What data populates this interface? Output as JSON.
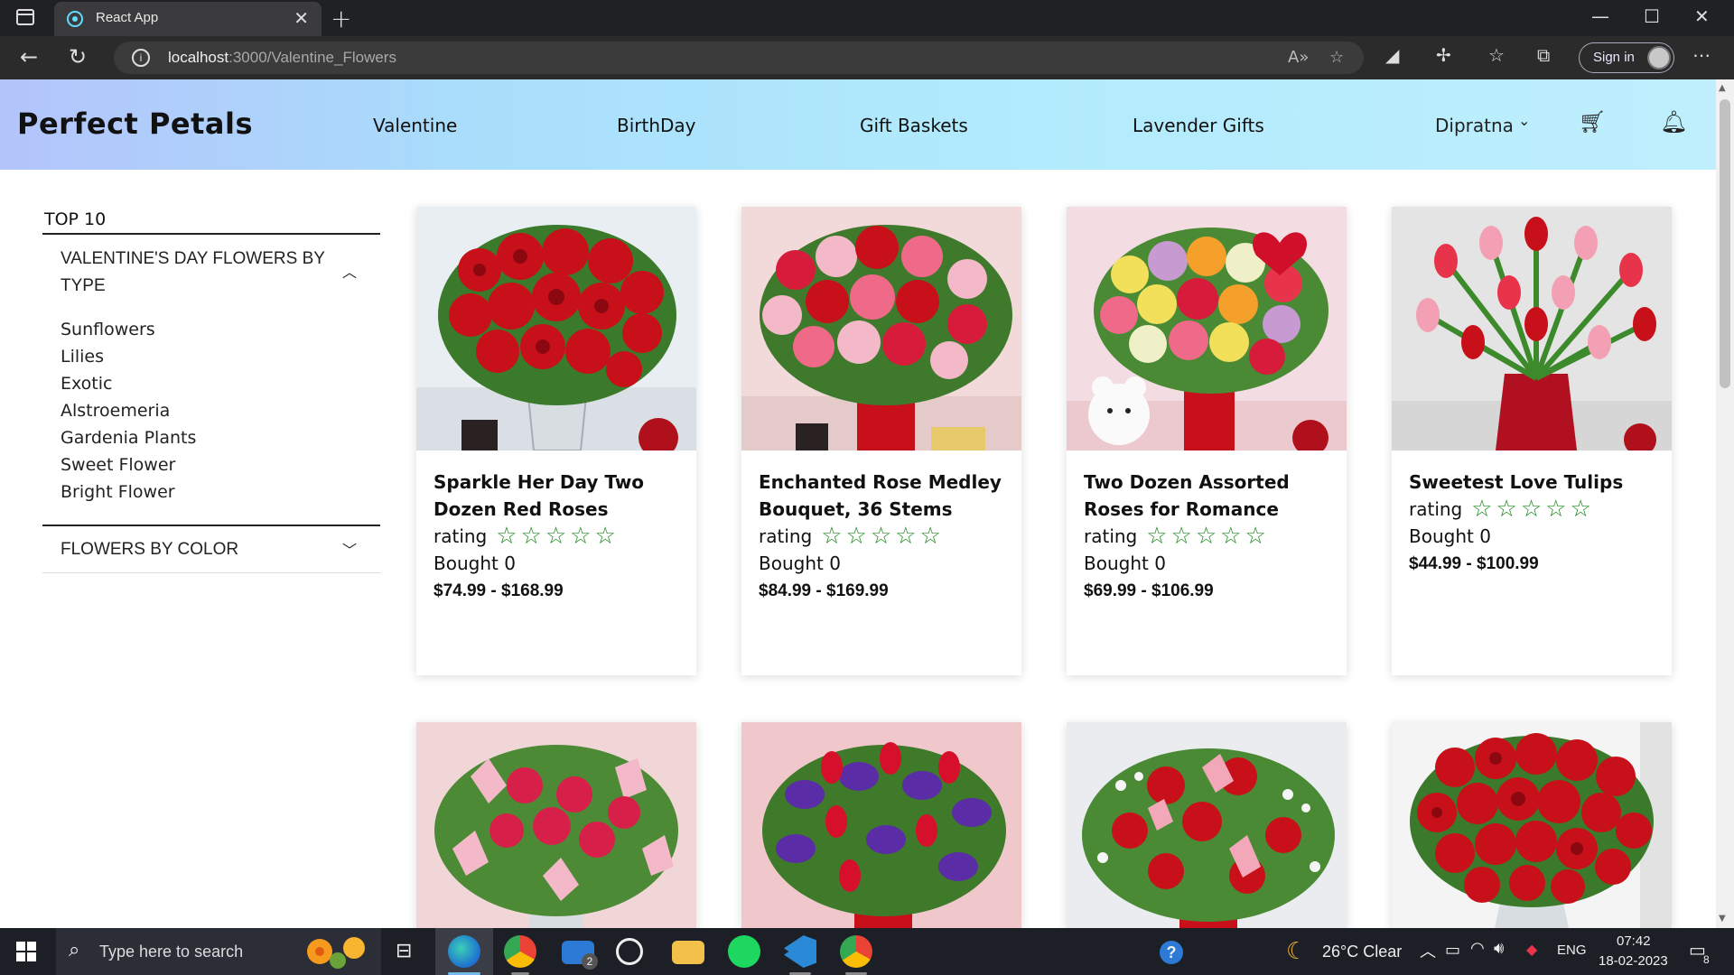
{
  "browser": {
    "tab_title": "React App",
    "tab_close": "✕",
    "new_tab": "+",
    "url_host": "localhost",
    "url_path": ":3000/Valentine_Flowers",
    "signin_label": "Sign in",
    "window_controls": [
      "—",
      "☐",
      "✕"
    ]
  },
  "header": {
    "brand": "Perfect Petals",
    "nav": [
      "Valentine",
      "BirthDay",
      "Gift Baskets",
      "Lavender Gifts"
    ],
    "user": "Dipratna",
    "icons": [
      "cart-icon",
      "bell-icon"
    ]
  },
  "sidebar": {
    "top": "TOP 10",
    "section1": "VALENTINE'S DAY FLOWERS BY TYPE",
    "items": [
      "Sunflowers",
      "Lilies",
      "Exotic",
      "Alstroemeria",
      "Gardenia Plants",
      "Sweet Flower",
      "Bright Flower"
    ],
    "section2": "FLOWERS BY COLOR"
  },
  "products": [
    {
      "title": "Sparkle Her Day Two Dozen Red Roses",
      "rating_label": "rating",
      "stars": "☆☆☆☆☆",
      "bought": "Bought 0",
      "price": "$74.99 - $168.99"
    },
    {
      "title": "Enchanted Rose Medley Bouquet, 36 Stems",
      "rating_label": "rating",
      "stars": "☆☆☆☆☆",
      "bought": "Bought 0",
      "price": "$84.99 - $169.99"
    },
    {
      "title": "Two Dozen Assorted Roses for Romance",
      "rating_label": "rating",
      "stars": "☆☆☆☆☆",
      "bought": "Bought 0",
      "price": "$69.99 - $106.99"
    },
    {
      "title": "Sweetest Love Tulips",
      "rating_label": "rating",
      "stars": "☆☆☆☆☆",
      "bought": "Bought 0",
      "price": "$44.99 - $100.99"
    }
  ],
  "taskbar": {
    "search_placeholder": "Type here to search",
    "mail_badge": "2",
    "weather": "26°C  Clear",
    "language": "ENG",
    "time": "07:42",
    "date": "18-02-2023",
    "notifications": "8"
  }
}
